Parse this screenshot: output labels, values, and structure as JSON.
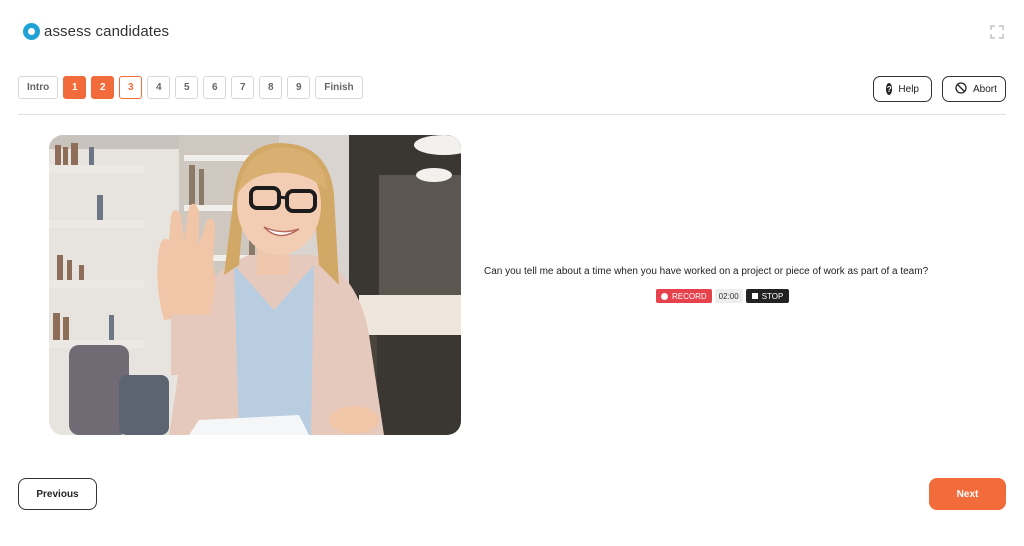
{
  "brand": {
    "name": "assess candidates",
    "logo_color": "#1fa3d6"
  },
  "header": {
    "fullscreen_icon": "expand-icon"
  },
  "steps": [
    {
      "label": "Intro",
      "state": "default"
    },
    {
      "label": "1",
      "state": "done"
    },
    {
      "label": "2",
      "state": "done"
    },
    {
      "label": "3",
      "state": "current"
    },
    {
      "label": "4",
      "state": "default"
    },
    {
      "label": "5",
      "state": "default"
    },
    {
      "label": "6",
      "state": "default"
    },
    {
      "label": "7",
      "state": "default"
    },
    {
      "label": "8",
      "state": "default"
    },
    {
      "label": "9",
      "state": "default"
    },
    {
      "label": "Finish",
      "state": "default"
    }
  ],
  "toolbar": {
    "help_label": "Help",
    "abort_label": "Abort"
  },
  "question": {
    "text": "Can you tell me about a time when you have worked on a project or piece of work as part of a team?"
  },
  "recorder": {
    "record_label": "RECORD",
    "timer": "02:00",
    "stop_label": "STOP"
  },
  "nav": {
    "previous_label": "Previous",
    "next_label": "Next"
  },
  "colors": {
    "accent": "#f26b3a",
    "record": "#e5424d",
    "dark": "#222222"
  }
}
